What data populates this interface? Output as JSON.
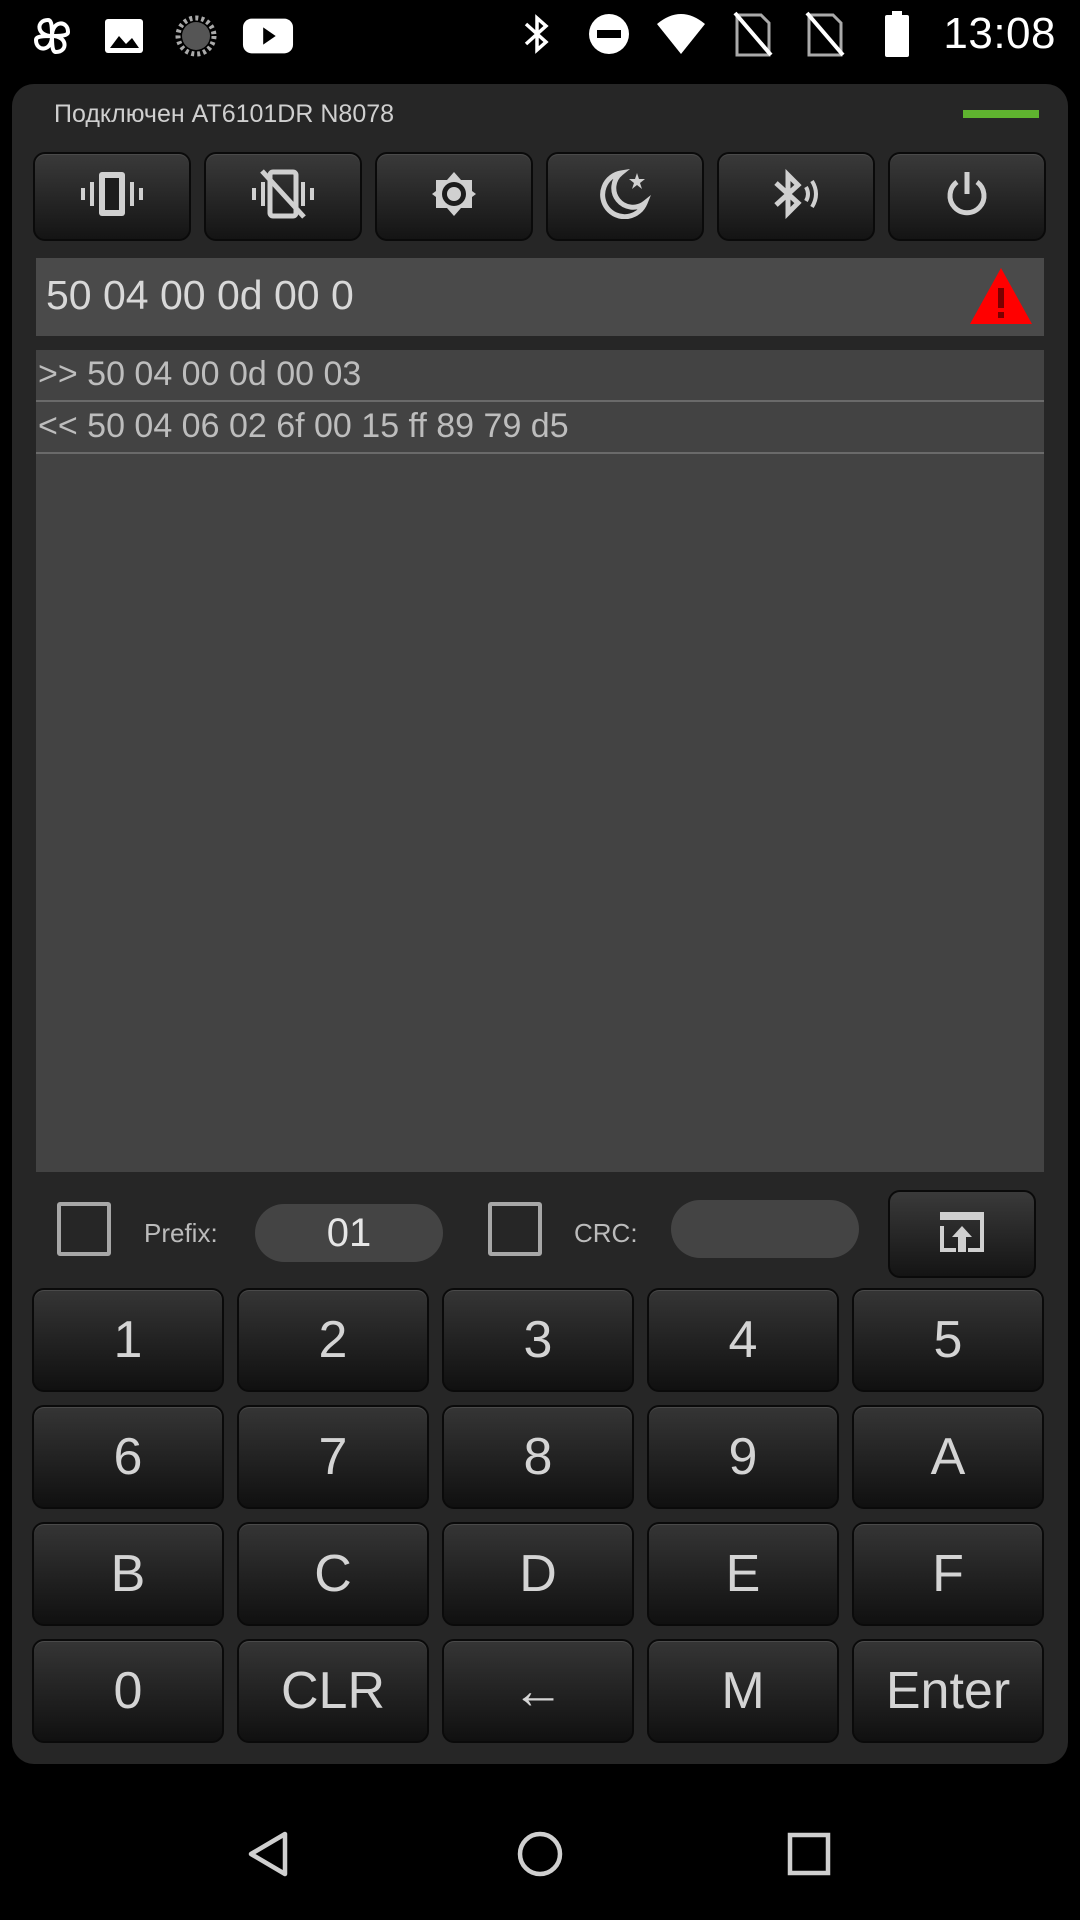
{
  "status_bar": {
    "time": "13:08",
    "left_icons": [
      "pinwheel-icon",
      "image-icon",
      "loading-icon",
      "youtube-icon"
    ],
    "right_icons": [
      "bluetooth-icon",
      "do-not-disturb-icon",
      "wifi-icon",
      "no-sim-icon",
      "no-sim-icon",
      "battery-icon"
    ]
  },
  "header": {
    "connection_status": "Подключен AT6101DR N8078",
    "indicator_color": "#5fb32f"
  },
  "toolbar": {
    "buttons": [
      {
        "icon": "vibrate-icon"
      },
      {
        "icon": "vibrate-off-icon"
      },
      {
        "icon": "brightness-icon"
      },
      {
        "icon": "night-mode-icon"
      },
      {
        "icon": "bluetooth-audio-icon"
      },
      {
        "icon": "power-icon"
      }
    ]
  },
  "command": {
    "value": "50 04 00 0d 00 0",
    "warning_icon": "warning-triangle-icon",
    "warning_color": "#ff0000"
  },
  "log": {
    "lines": [
      ">> 50 04 00 0d 00 03",
      "<< 50 04 06 02 6f 00 15 ff 89 79 d5"
    ]
  },
  "options": {
    "prefix_label": "Prefix:",
    "prefix_value": "01",
    "crc_label": "CRC:",
    "crc_value": ""
  },
  "keypad": {
    "keys": [
      "1",
      "2",
      "3",
      "4",
      "5",
      "6",
      "7",
      "8",
      "9",
      "A",
      "B",
      "C",
      "D",
      "E",
      "F",
      "0",
      "CLR",
      "←",
      "M",
      "Enter"
    ]
  },
  "nav": {
    "icons": [
      "back-icon",
      "home-icon",
      "recents-icon"
    ]
  }
}
